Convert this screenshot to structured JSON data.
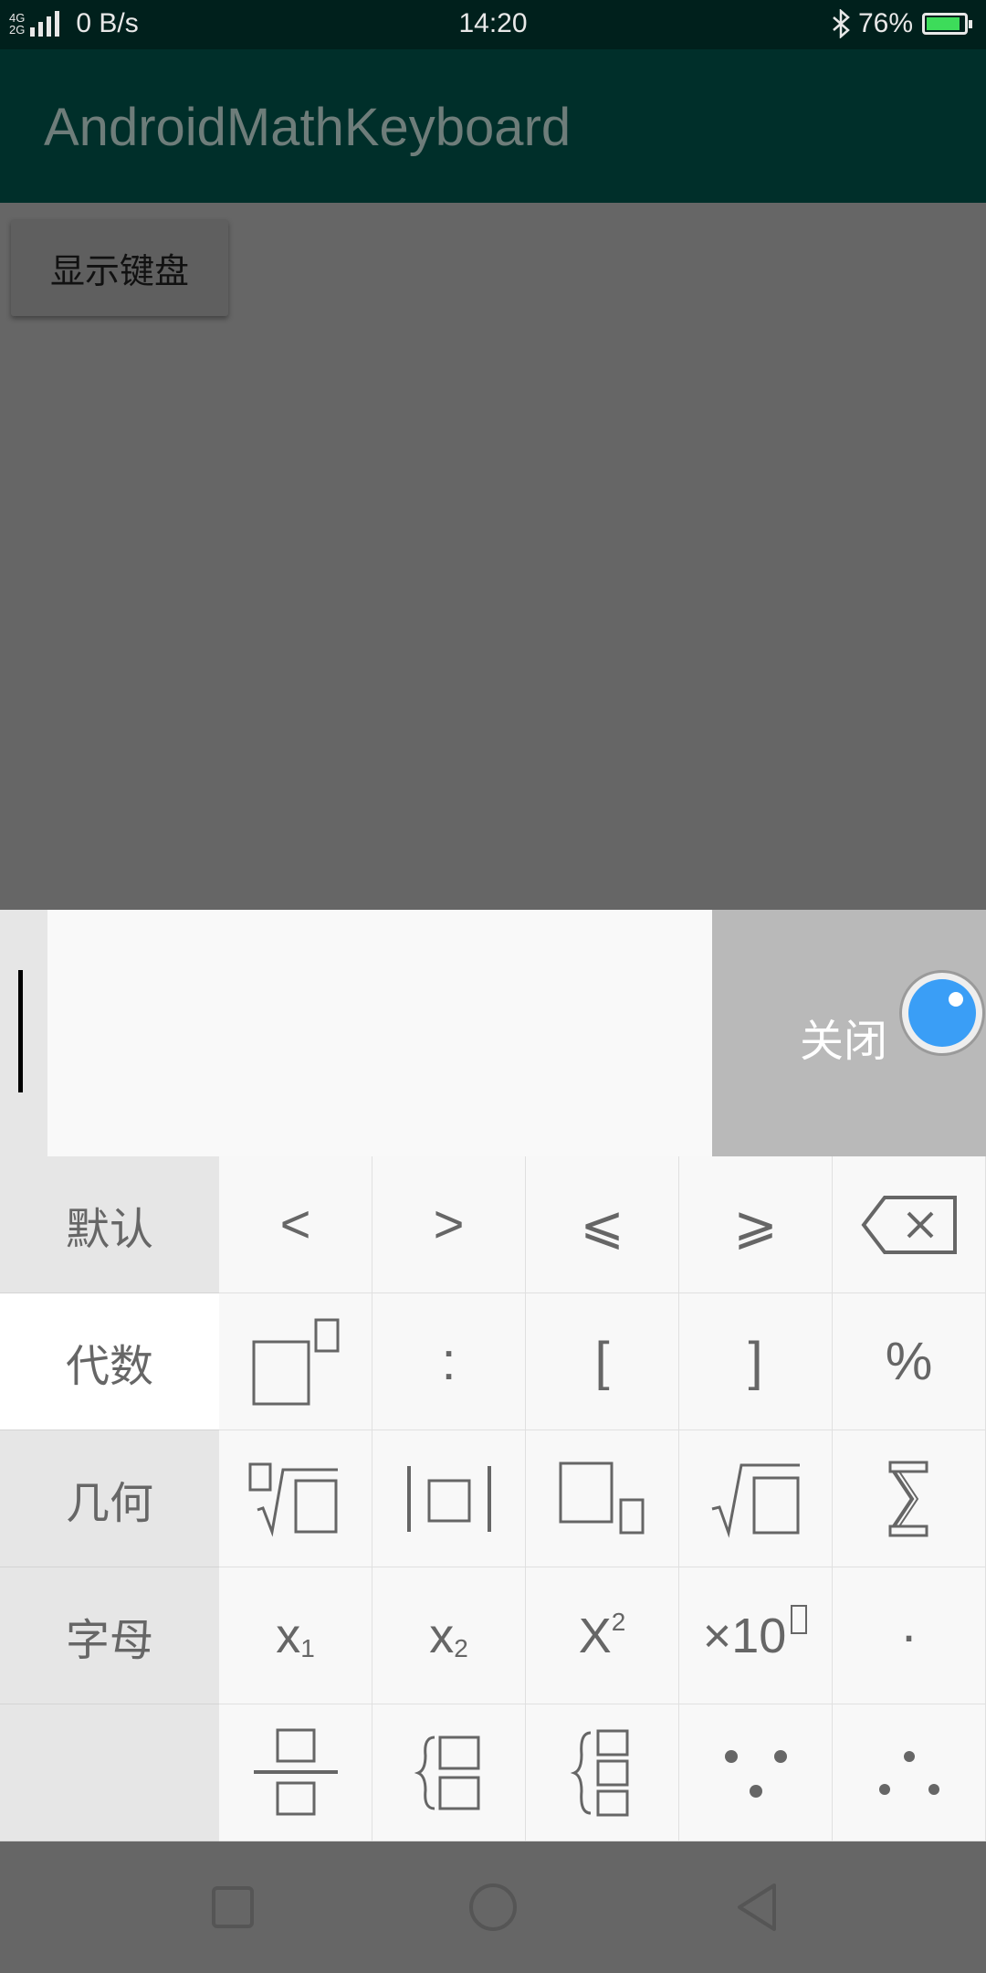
{
  "status_bar": {
    "network_top": "4G",
    "network_bottom": "2G",
    "speed": "0 B/s",
    "time": "14:20",
    "battery": "76%",
    "battery_level": 0.76,
    "icons": [
      "signal-icon",
      "bluetooth-icon",
      "battery-icon"
    ]
  },
  "app_bar": {
    "title": "AndroidMathKeyboard"
  },
  "content": {
    "show_keyboard_label": "显示键盘"
  },
  "keyboard": {
    "close_label": "关闭",
    "categories": [
      {
        "label": "默认",
        "active": false
      },
      {
        "label": "代数",
        "active": true
      },
      {
        "label": "几何",
        "active": false
      },
      {
        "label": "字母",
        "active": false
      },
      {
        "label": "",
        "active": false
      }
    ],
    "keys": {
      "row1": [
        "<",
        ">",
        "⩽",
        "⩾",
        "delete"
      ],
      "row2": [
        "power",
        ":",
        "[",
        "]",
        "%"
      ],
      "row3": [
        "nth-root",
        "abs",
        "subscript-box",
        "sqrt",
        "sum"
      ],
      "row4": [
        "x1",
        "x2",
        "x²",
        "×10ⁿ",
        "·"
      ],
      "row5": [
        "fraction",
        "system-2",
        "system-3",
        "because",
        "therefore"
      ]
    },
    "text": {
      "lt": "<",
      "gt": ">",
      "le": "⩽",
      "ge": "⩾",
      "colon": ":",
      "lbracket": "[",
      "rbracket": "]",
      "percent": "%",
      "x": "x",
      "X": "X",
      "sub1": "1",
      "sub2": "2",
      "sup2": "2",
      "times10": "×10",
      "dot": "·"
    }
  },
  "colors": {
    "status_bar": "#00201c",
    "app_bar": "#002f2a",
    "scrim": "#666666",
    "accent_knob": "#3a9ef6"
  }
}
